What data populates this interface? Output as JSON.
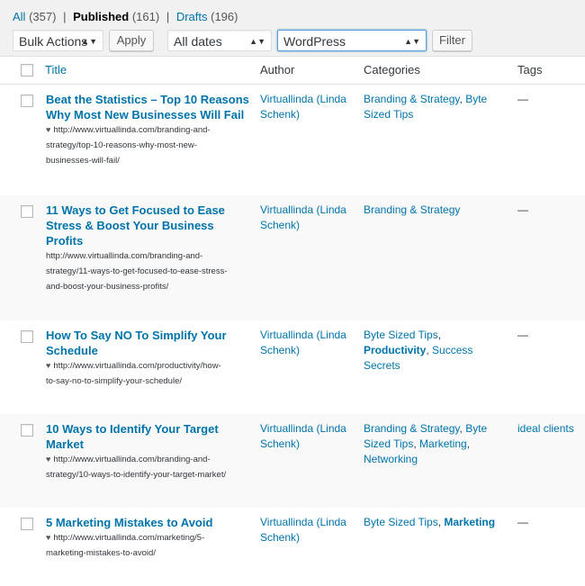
{
  "filters": {
    "all_label": "All",
    "all_count": "(357)",
    "published_label": "Published",
    "published_count": "(161)",
    "drafts_label": "Drafts",
    "drafts_count": "(196)",
    "separator": "|"
  },
  "toolbar": {
    "bulk_actions": "Bulk Actions",
    "apply": "Apply",
    "dates": "All dates",
    "category": "WordPress",
    "filter": "Filter"
  },
  "columns": {
    "title": "Title",
    "author": "Author",
    "categories": "Categories",
    "tags": "Tags"
  },
  "rows": [
    {
      "title_lines": [
        "Beat the Statistics – Top 10 Reasons",
        "Why Most New Businesses Will Fail"
      ],
      "has_heart": true,
      "url_lines": [
        "http://www.virtuallinda.com/branding-and-",
        "strategy/top-10-reasons-why-most-new-",
        "businesses-will-fail/"
      ],
      "author_lines": [
        "Virtuallinda (Linda",
        "Schenk)"
      ],
      "categories": [
        {
          "text": "Branding & Strategy",
          "link": true,
          "bold": false
        },
        {
          "text": ", ",
          "link": false,
          "bold": false
        },
        {
          "text": "Byte Sized Tips",
          "link": true,
          "bold": false
        }
      ],
      "tags": "—"
    },
    {
      "title_lines": [
        "11 Ways to Get Focused to Ease",
        "Stress & Boost Your Business",
        "Profits"
      ],
      "has_heart": false,
      "url_lines": [
        "http://www.virtuallinda.com/branding-and-",
        "strategy/11-ways-to-get-focused-to-ease-stress-",
        "and-boost-your-business-profits/"
      ],
      "author_lines": [
        "Virtuallinda (Linda",
        "Schenk)"
      ],
      "categories": [
        {
          "text": "Branding & Strategy",
          "link": true,
          "bold": false
        }
      ],
      "tags": "—"
    },
    {
      "title_lines": [
        "How To Say NO To Simplify Your",
        "Schedule"
      ],
      "has_heart": true,
      "url_lines": [
        "http://www.virtuallinda.com/productivity/how-",
        "to-say-no-to-simplify-your-schedule/"
      ],
      "author_lines": [
        "Virtuallinda (Linda",
        "Schenk)"
      ],
      "categories": [
        {
          "text": "Byte Sized Tips",
          "link": true,
          "bold": false
        },
        {
          "text": ", ",
          "link": false,
          "bold": false
        },
        {
          "text": "Productivity",
          "link": true,
          "bold": true
        },
        {
          "text": ", ",
          "link": false,
          "bold": false
        },
        {
          "text": "Success Secrets",
          "link": true,
          "bold": false
        }
      ],
      "tags": "—"
    },
    {
      "title_lines": [
        "10 Ways to Identify Your Target",
        "Market"
      ],
      "has_heart": true,
      "url_lines": [
        "http://www.virtuallinda.com/branding-and-",
        "strategy/10-ways-to-identify-your-target-market/"
      ],
      "author_lines": [
        "Virtuallinda (Linda",
        "Schenk)"
      ],
      "categories": [
        {
          "text": "Branding & Strategy",
          "link": true,
          "bold": false
        },
        {
          "text": ", ",
          "link": false,
          "bold": false
        },
        {
          "text": "Byte Sized Tips",
          "link": true,
          "bold": false
        },
        {
          "text": ", ",
          "link": false,
          "bold": false
        },
        {
          "text": "Marketing",
          "link": true,
          "bold": false
        },
        {
          "text": ", ",
          "link": false,
          "bold": false
        },
        {
          "text": "Networking",
          "link": true,
          "bold": false
        }
      ],
      "tags": "ideal clients"
    },
    {
      "title_lines": [
        "5 Marketing Mistakes to Avoid"
      ],
      "has_heart": true,
      "url_lines": [
        "http://www.virtuallinda.com/marketing/5-",
        "marketing-mistakes-to-avoid/"
      ],
      "author_lines": [
        "Virtuallinda (Linda",
        "Schenk)"
      ],
      "categories": [
        {
          "text": "Byte Sized Tips",
          "link": true,
          "bold": false
        },
        {
          "text": ", ",
          "link": false,
          "bold": false
        },
        {
          "text": "Marketing",
          "link": true,
          "bold": true
        }
      ],
      "tags": "—"
    }
  ],
  "colors": {
    "link": "#0073aa",
    "text": "#32373c",
    "alt_row": "#f9f9f9",
    "page_bg": "#f1f1f1"
  }
}
